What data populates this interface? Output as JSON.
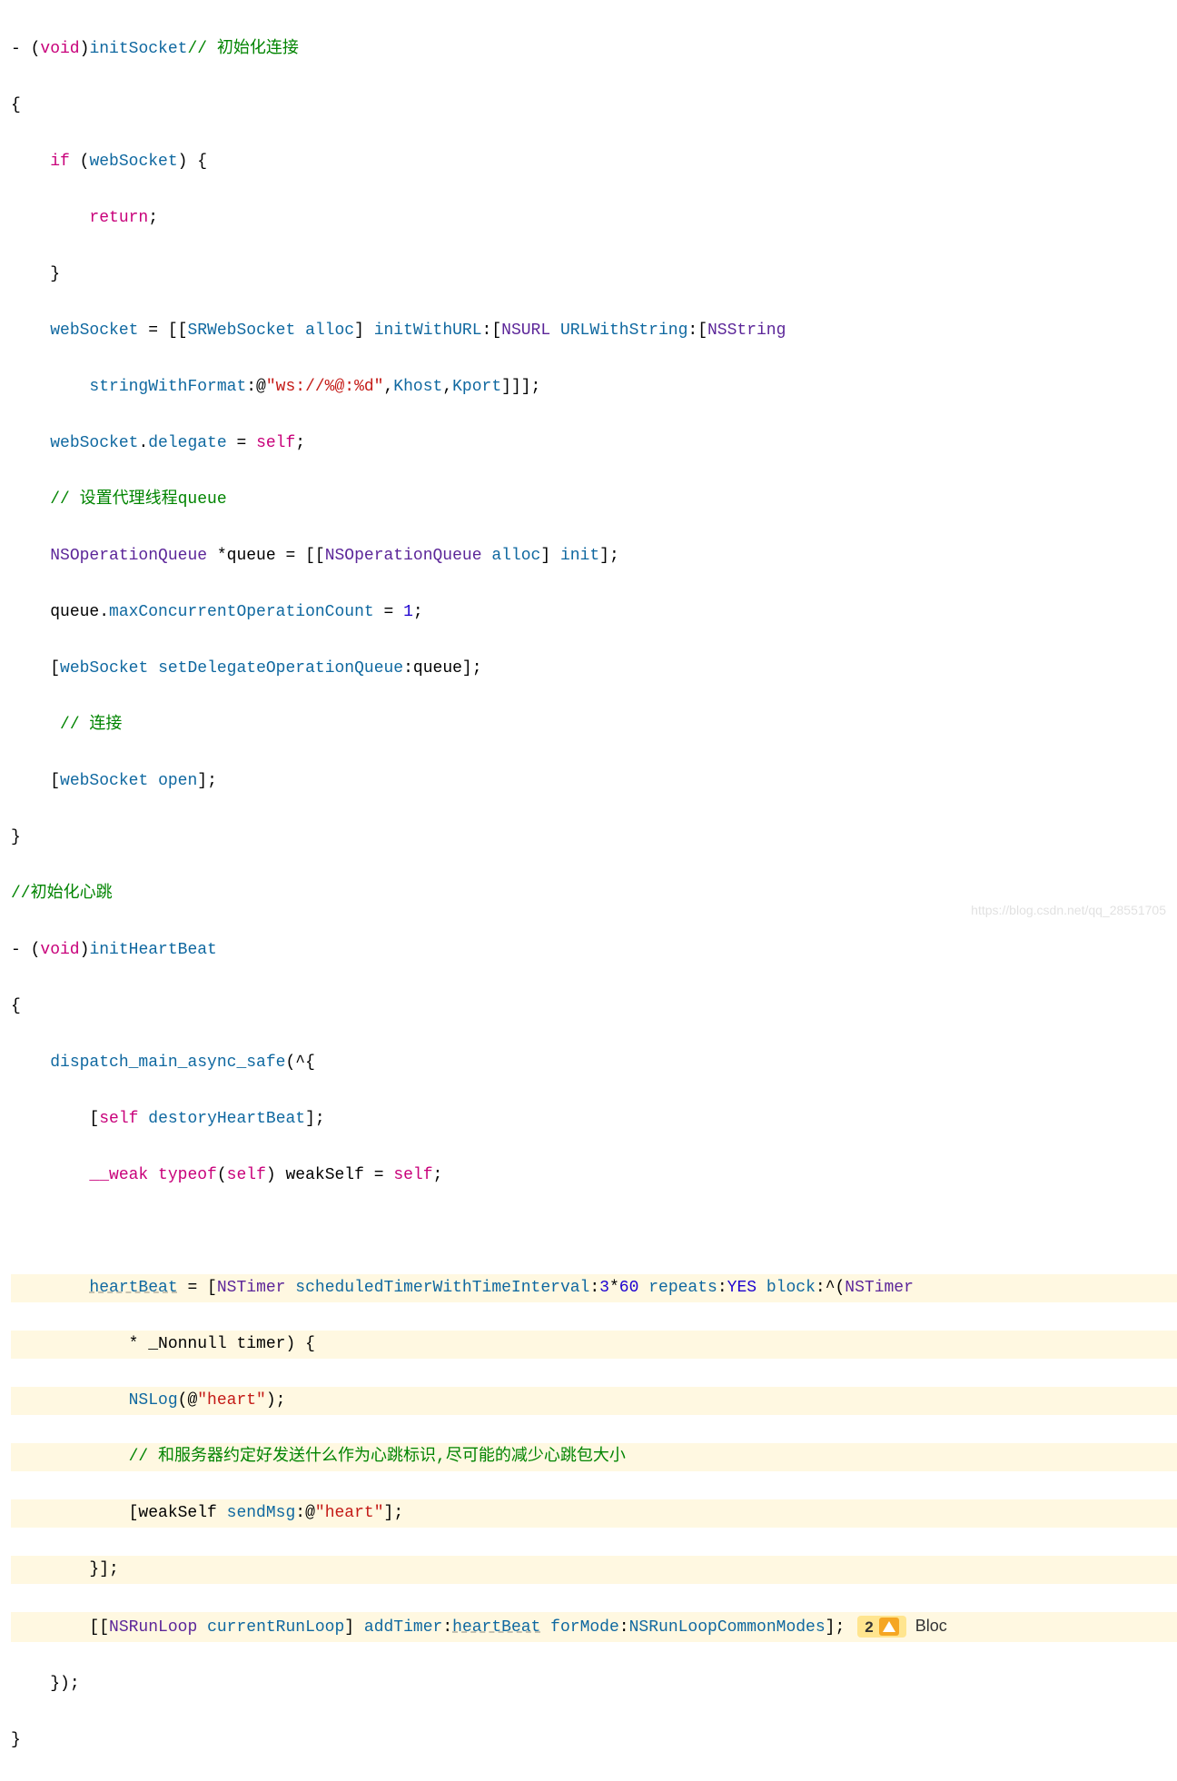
{
  "wm": "https://blog.csdn.net/qq_28551705",
  "badge": {
    "count": "2",
    "text": "Bloc"
  },
  "t": {
    "minus": "- (",
    "void": "void",
    "rp": ")",
    "initSocket": "initSocket",
    "cmt_init": "// 初始化连接",
    "ob": "{",
    "cb": "}",
    "if": "if",
    "sp": " ",
    "op": "(",
    "webSocket": "webSocket",
    "rp2": ") {",
    "return": "return",
    "semi": ";",
    "assign": " = [[",
    "SRWebSocket": "SRWebSocket",
    "alloc": " alloc",
    "rb": "] ",
    "initWithURL": "initWithURL",
    "colon": ":",
    "lb": "[",
    "NSURL": "NSURL",
    "URLWithString": " URLWithString",
    "NSString": "NSString",
    "stringWithFormat": "stringWithFormat",
    "at": ":@",
    "str_ws": "\"ws://%@:%d\"",
    "comma": ",",
    "Khost": "Khost",
    "Kport": "Kport",
    "rbb": "]]];",
    "dot": ".",
    "delegate": "delegate",
    "eq": " = ",
    "self": "self",
    "cmt_queue": "// 设置代理线程queue",
    "NSOperationQueue": "NSOperationQueue",
    "star": " *",
    "queue": "queue",
    "alloc2": " alloc",
    "init": " init",
    "rb2": "];",
    "maxConc": "maxConcurrentOperationCount",
    "eq1": " = ",
    "one": "1",
    "setDelegateOpQ": "setDelegateOperationQueue",
    "cmt_conn": " // 连接",
    "open": "open",
    "cmt_heart": "//初始化心跳",
    "initHeartBeat": "initHeartBeat",
    "dmas": "dispatch_main_async_safe",
    "blockOpen": "(^{",
    "destoryHB": "destoryHeartBeat",
    "weak": "__weak",
    "typeof": "typeof",
    "weakSelf": "weakSelf",
    "heartBeat": "heartBeat",
    "NSTimer": "NSTimer",
    "sched": "scheduledTimerWithTimeInterval",
    "n3": "3",
    "mul": "*",
    "n60": "60",
    "repeats": "repeats",
    "YES": "YES",
    "block": "block",
    "caret": ":^(",
    "Nonnull": "* _Nonnull ",
    "timer": "timer",
    "pob": ") {",
    "NSLog": "NSLog",
    "heartStr": "\"heart\"",
    "cmt_srv": "// 和服务器约定好发送什么作为心跳标识,尽可能的减少心跳包大小",
    "sendMsg": "sendMsg",
    "cbSq": "}];",
    "NSRunLoop": "NSRunLoop",
    "currentRunLoop": "currentRunLoop",
    "addTimer": "addTimer",
    "forMode": "forMode",
    "NSRunLoopCommonModes": "NSRunLoopCommonModes",
    "blockClose": "});"
  }
}
